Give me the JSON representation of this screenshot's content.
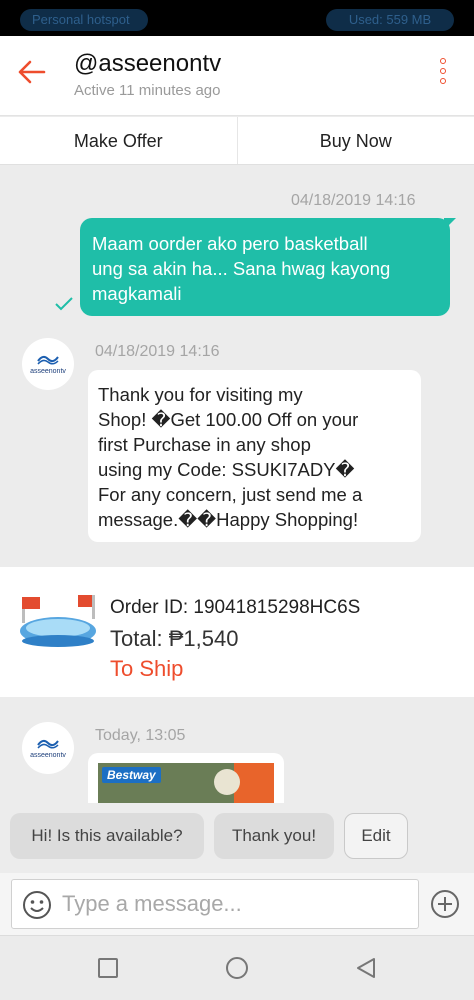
{
  "status_bar": {
    "left_pill": "Personal hotspot",
    "right_pill": "Used: 559 MB"
  },
  "header": {
    "title": "@asseenontv",
    "subtitle": "Active 11 minutes ago",
    "back_icon": "back-arrow-icon",
    "menu_icon": "more-vertical-icon",
    "accent_color": "#ee4d2d"
  },
  "actions": {
    "make_offer": "Make Offer",
    "buy_now": "Buy Now"
  },
  "messages": [
    {
      "timestamp": "04/18/2019 14:16",
      "direction": "outgoing",
      "lines": [
        "Maam oorder ako pero basketball",
        "ung sa akin ha... Sana hwag kayong",
        "magkamali"
      ],
      "bubble_color": "#1fbea8",
      "read_icon": "check-icon"
    },
    {
      "timestamp": "04/18/2019 14:16",
      "direction": "incoming",
      "avatar_label": "asseenontv",
      "lines": [
        "Thank you for visiting my",
        "Shop! �Get 100.00 Off on your",
        "first Purchase in any shop",
        "using my Code: SSUKI7ADY�",
        "For any concern, just send me a",
        "message.��Happy Shopping!"
      ]
    },
    {
      "timestamp": "Today, 13:05",
      "direction": "incoming",
      "avatar_label": "asseenontv",
      "image_brand": "Bestway"
    }
  ],
  "order": {
    "id": "Order ID: 19041815298HC6S",
    "total": "Total: ₱1,540",
    "status": "To Ship"
  },
  "quick_replies": [
    "Hi! Is this available?",
    "Thank you!",
    "Edit"
  ],
  "input": {
    "placeholder": "Type a message...",
    "emoji_icon": "emoji-icon",
    "plus_icon": "plus-circle-icon"
  },
  "nav": [
    "square-icon",
    "circle-icon",
    "triangle-back-icon"
  ]
}
